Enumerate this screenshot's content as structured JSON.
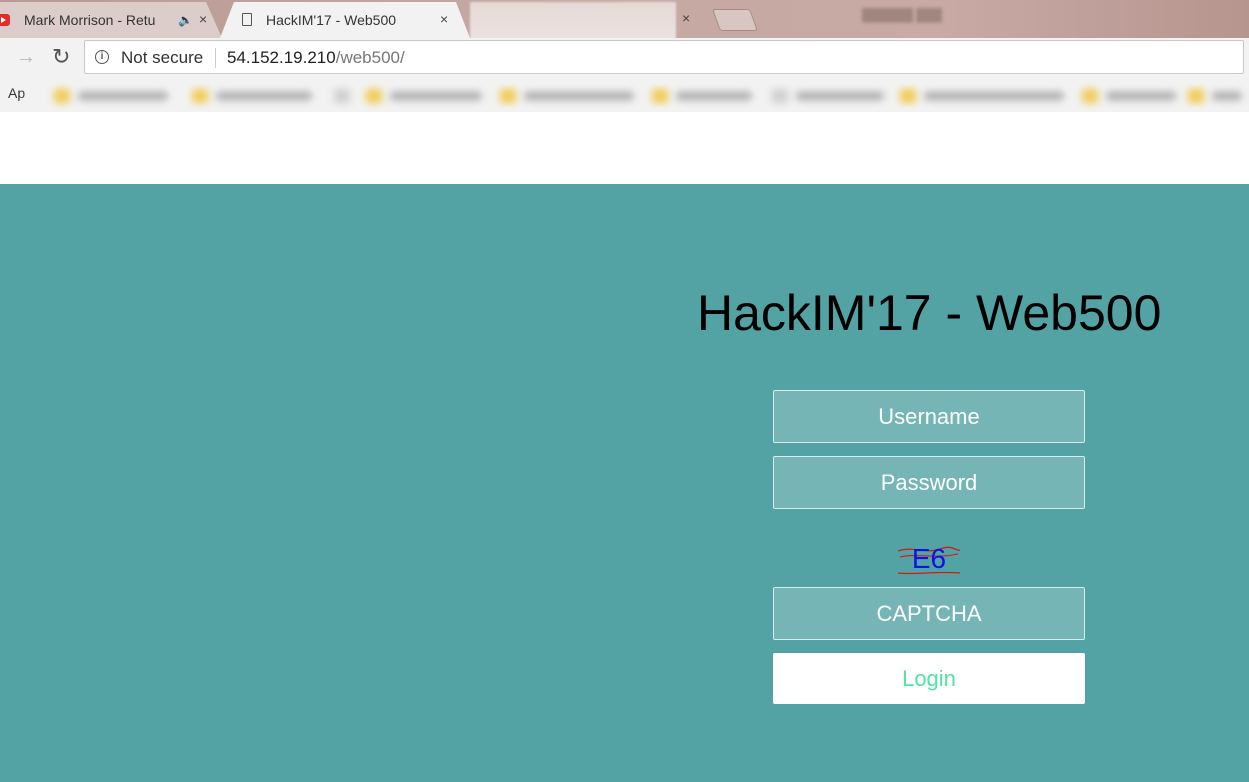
{
  "browser": {
    "tabs": [
      {
        "title": "Mark Morrison - Retu",
        "audio_icon": "speaker-icon",
        "favicon": "youtube-icon"
      },
      {
        "title": "HackIM'17 - Web500",
        "favicon": "document-icon",
        "active": true
      }
    ],
    "close_glyph": "×",
    "address_bar": {
      "security_label": "Not secure",
      "url_host": "54.152.19.210",
      "url_path": "/web500/"
    },
    "bookmarks": {
      "apps_label": "Ap"
    }
  },
  "page": {
    "title": "HackIM'17 - Web500",
    "username_placeholder": "Username",
    "password_placeholder": "Password",
    "captcha_text": "E6",
    "captcha_placeholder": "CAPTCHA",
    "login_label": "Login"
  },
  "colors": {
    "page_background": "#53a3a4",
    "login_text": "#53e3a6",
    "captcha_text": "#1010ee",
    "captcha_lines": "#d11a1a"
  }
}
